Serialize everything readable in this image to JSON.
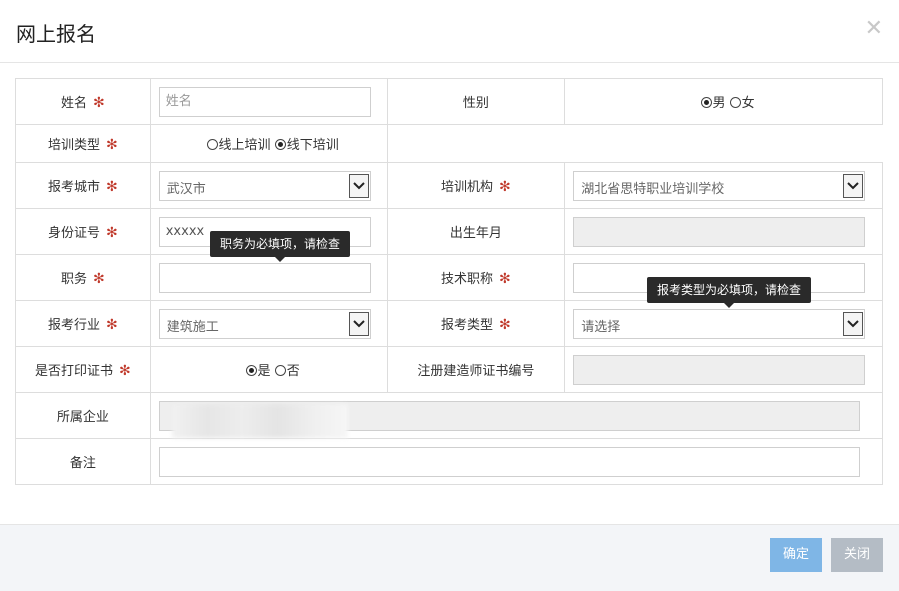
{
  "dialog": {
    "title": "网上报名",
    "close_glyph": "✕"
  },
  "required_mark": "✻",
  "fields": {
    "name": {
      "label": "姓名",
      "placeholder": "姓名"
    },
    "gender": {
      "label": "性别",
      "options": [
        "男",
        "女"
      ],
      "selected": "男"
    },
    "training_type": {
      "label": "培训类型",
      "options": [
        "线上培训",
        "线下培训"
      ],
      "selected": "线下培训"
    },
    "exam_city": {
      "label": "报考城市",
      "value": "武汉市"
    },
    "training_org": {
      "label": "培训机构",
      "value": "湖北省思特职业培训学校"
    },
    "id_number": {
      "label": "身份证号",
      "value": "xxxxx"
    },
    "birth_date": {
      "label": "出生年月"
    },
    "position": {
      "label": "职务",
      "tooltip": "职务为必填项，请检查"
    },
    "tech_title": {
      "label": "技术职称"
    },
    "exam_industry": {
      "label": "报考行业",
      "value": "建筑施工"
    },
    "exam_type": {
      "label": "报考类型",
      "value": "请选择",
      "tooltip": "报考类型为必填项，请检查"
    },
    "print_cert": {
      "label": "是否打印证书",
      "options": [
        "是",
        "否"
      ],
      "selected": "是"
    },
    "constructor_cert_no": {
      "label": "注册建造师证书编号"
    },
    "company": {
      "label": "所属企业"
    },
    "remarks": {
      "label": "备注"
    }
  },
  "footer": {
    "confirm_label": "确定",
    "close_label": "关闭"
  },
  "colors": {
    "required": "#c0392b",
    "confirm_btn": "#7fb6e6",
    "close_btn": "#b4bcc5",
    "tooltip_bg": "#2a2a2a"
  }
}
